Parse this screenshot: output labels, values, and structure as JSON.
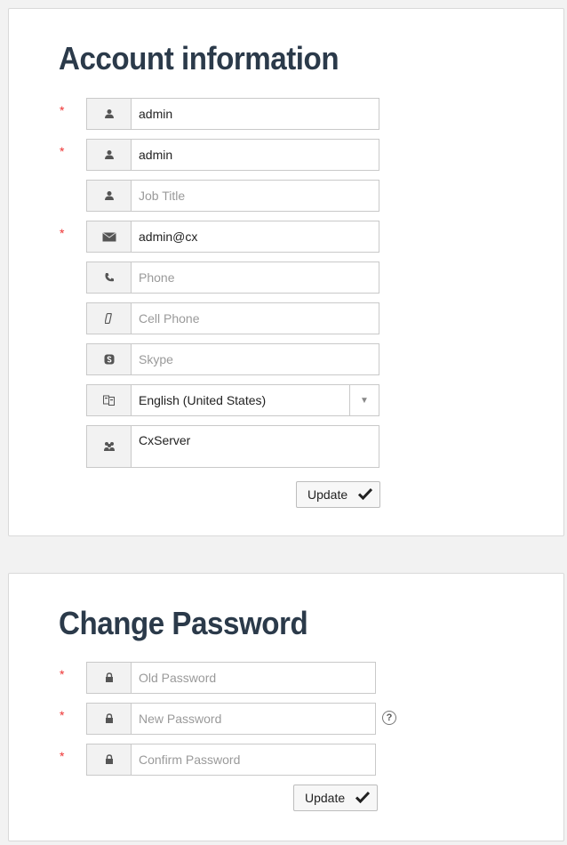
{
  "account": {
    "title": "Account information",
    "fields": [
      {
        "value": "admin",
        "required": true,
        "icon": "user-icon"
      },
      {
        "value": "admin",
        "required": true,
        "icon": "user-icon"
      },
      {
        "placeholder": "Job Title",
        "required": false,
        "icon": "user-icon"
      },
      {
        "value": "admin@cx",
        "required": true,
        "icon": "envelope-icon"
      },
      {
        "placeholder": "Phone",
        "required": false,
        "icon": "phone-icon"
      },
      {
        "placeholder": "Cell Phone",
        "required": false,
        "icon": "mobile-icon"
      },
      {
        "placeholder": "Skype",
        "required": false,
        "icon": "skype-icon"
      },
      {
        "value": "English (United States)",
        "required": false,
        "icon": "language-icon",
        "type": "select"
      },
      {
        "value": "CxServer",
        "required": false,
        "icon": "team-icon"
      }
    ],
    "update_label": "Update"
  },
  "password": {
    "title": "Change Password",
    "fields": [
      {
        "placeholder": "Old Password",
        "required": true,
        "icon": "lock-icon"
      },
      {
        "placeholder": "New Password",
        "required": true,
        "icon": "lock-icon"
      },
      {
        "placeholder": "Confirm Password",
        "required": true,
        "icon": "lock-icon"
      }
    ],
    "help_text": "?",
    "update_label": "Update"
  },
  "required_mark": "*",
  "colors": {
    "required": "#ee3333",
    "title": "#2b3a4a"
  }
}
